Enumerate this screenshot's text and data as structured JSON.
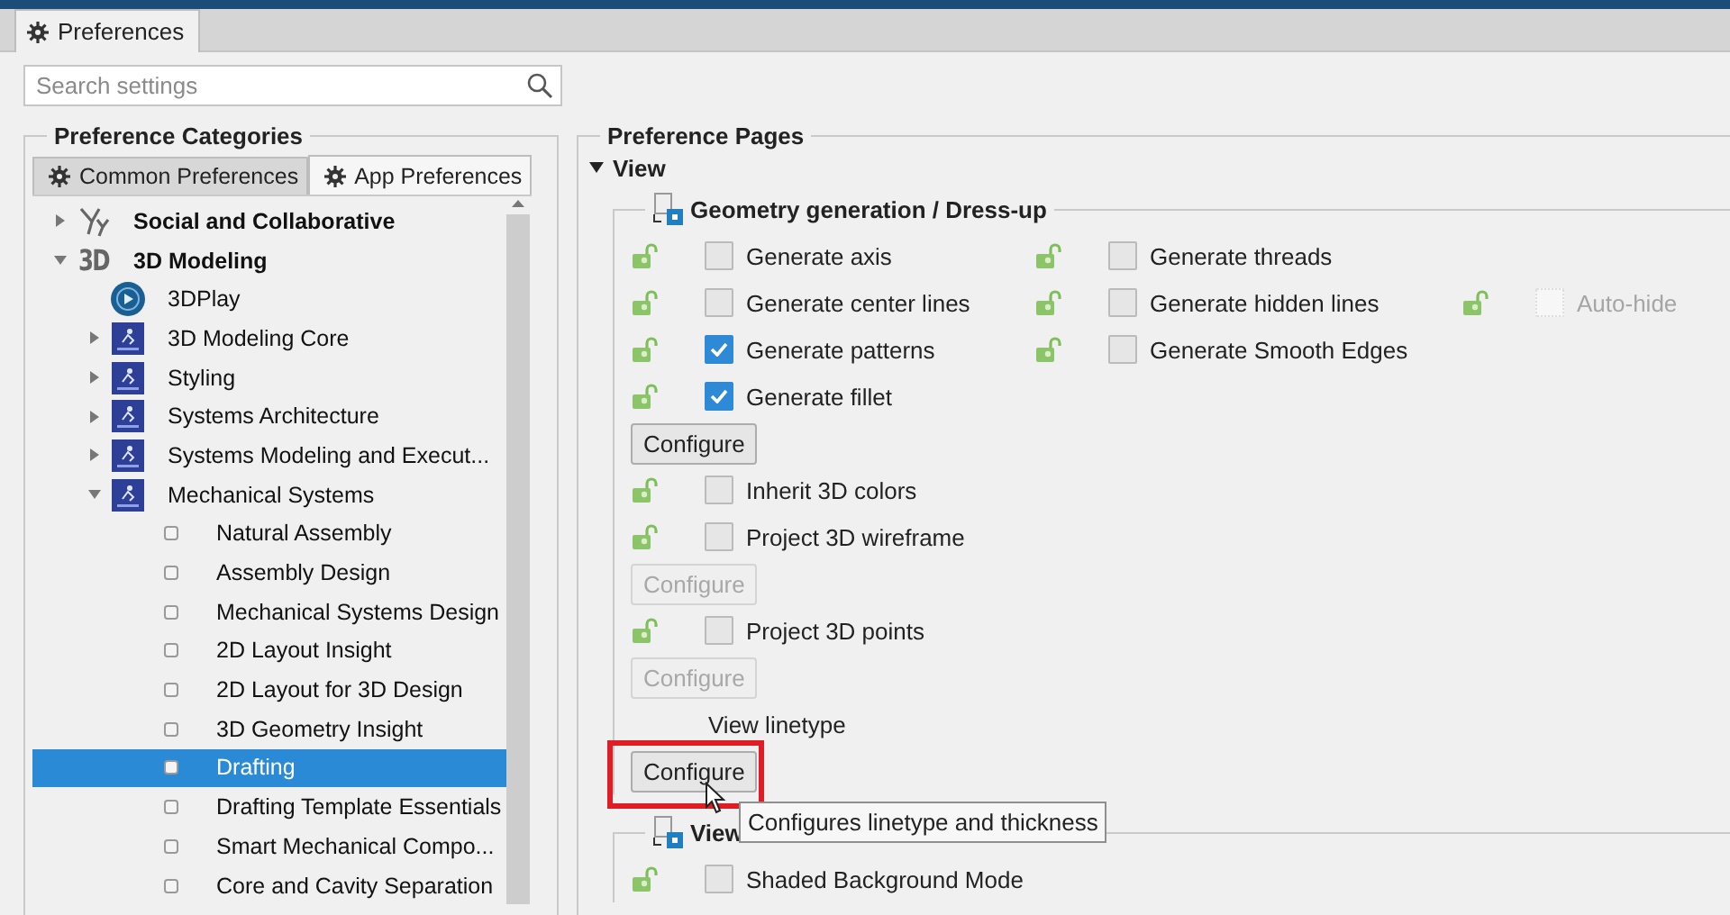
{
  "window": {
    "tab": "Preferences"
  },
  "search": {
    "placeholder": "Search settings"
  },
  "categories": {
    "title": "Preference Categories",
    "tabs": [
      {
        "label": "Common Preferences",
        "selected": false
      },
      {
        "label": "App Preferences",
        "selected": true
      }
    ],
    "tree": [
      {
        "label": "Social and Collaborative",
        "kind": "social",
        "expanded": false,
        "selected": false
      },
      {
        "label": "3D Modeling",
        "kind": "brand",
        "badge": "3D",
        "expanded": true,
        "selected": false,
        "children": [
          {
            "label": "3DPlay",
            "kind": "globe",
            "selected": false
          },
          {
            "label": "3D Modeling Core",
            "kind": "app",
            "expanded": false,
            "selected": false
          },
          {
            "label": "Styling",
            "kind": "app",
            "expanded": false,
            "selected": false
          },
          {
            "label": "Systems Architecture",
            "kind": "app",
            "expanded": false,
            "selected": false
          },
          {
            "label": "Systems Modeling and Execut...",
            "kind": "app",
            "expanded": false,
            "selected": false
          },
          {
            "label": "Mechanical Systems",
            "kind": "app",
            "expanded": true,
            "selected": false,
            "children": [
              {
                "label": "Natural Assembly",
                "kind": "page",
                "selected": false
              },
              {
                "label": "Assembly Design",
                "kind": "page",
                "selected": false
              },
              {
                "label": "Mechanical Systems Design",
                "kind": "page",
                "selected": false
              },
              {
                "label": "2D Layout Insight",
                "kind": "page",
                "selected": false
              },
              {
                "label": "2D Layout for 3D Design",
                "kind": "page",
                "selected": false
              },
              {
                "label": "3D Geometry Insight",
                "kind": "page",
                "selected": false
              },
              {
                "label": "Drafting",
                "kind": "page",
                "selected": true
              },
              {
                "label": "Drafting Template Essentials",
                "kind": "page",
                "selected": false
              },
              {
                "label": "Smart Mechanical Compo...",
                "kind": "page",
                "selected": false
              },
              {
                "label": "Core and Cavity Separation",
                "kind": "page",
                "selected": false
              }
            ]
          }
        ]
      }
    ]
  },
  "pages": {
    "title": "Preference Pages",
    "section": {
      "label": "View",
      "expanded": true
    },
    "groups": [
      {
        "title": "Geometry generation / Dress-up",
        "rows": [
          {
            "kind": "checks",
            "items": [
              {
                "label": "Generate axis",
                "checked": false,
                "disabled": false
              },
              {
                "label": "Generate threads",
                "checked": false,
                "disabled": false
              }
            ]
          },
          {
            "kind": "checks",
            "items": [
              {
                "label": "Generate center lines",
                "checked": false,
                "disabled": false
              },
              {
                "label": "Generate hidden lines",
                "checked": false,
                "disabled": false
              },
              {
                "label": "Auto-hide",
                "checked": false,
                "disabled": true
              }
            ]
          },
          {
            "kind": "checks",
            "items": [
              {
                "label": "Generate patterns",
                "checked": true,
                "disabled": false
              },
              {
                "label": "Generate Smooth Edges",
                "checked": false,
                "disabled": false
              }
            ]
          },
          {
            "kind": "checks",
            "items": [
              {
                "label": "Generate fillet",
                "checked": true,
                "disabled": false
              }
            ]
          },
          {
            "kind": "button",
            "label": "Configure",
            "disabled": false,
            "highlighted": false
          },
          {
            "kind": "checks",
            "items": [
              {
                "label": "Inherit 3D colors",
                "checked": false,
                "disabled": false
              }
            ]
          },
          {
            "kind": "checks",
            "items": [
              {
                "label": "Project 3D wireframe",
                "checked": false,
                "disabled": false
              }
            ]
          },
          {
            "kind": "button",
            "label": "Configure",
            "disabled": true,
            "highlighted": false
          },
          {
            "kind": "checks",
            "items": [
              {
                "label": "Project 3D points",
                "checked": false,
                "disabled": false
              }
            ]
          },
          {
            "kind": "button",
            "label": "Configure",
            "disabled": true,
            "highlighted": false
          },
          {
            "kind": "label",
            "text": "View linetype"
          },
          {
            "kind": "button",
            "label": "Configure",
            "disabled": false,
            "highlighted": true,
            "tooltip": "Configures linetype and thickness"
          }
        ]
      },
      {
        "title": "View",
        "rows": [
          {
            "kind": "checks",
            "items": [
              {
                "label": "Shaded Background Mode",
                "checked": false,
                "disabled": false
              }
            ]
          }
        ]
      }
    ]
  }
}
